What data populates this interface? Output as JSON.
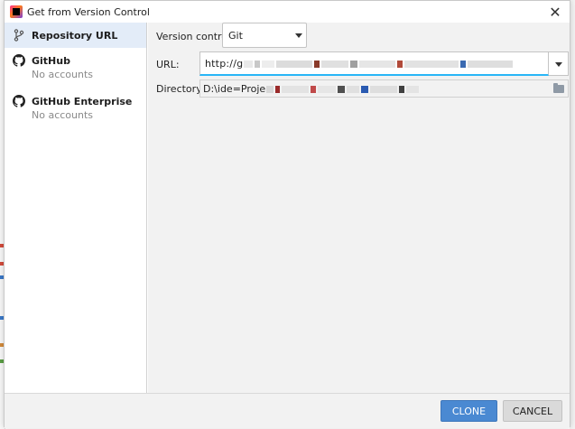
{
  "window": {
    "title": "Get from Version Control",
    "close_glyph": "✕"
  },
  "sidebar": {
    "items": [
      {
        "label": "Repository URL",
        "sublabel": "",
        "icon": "branch-icon",
        "selected": true
      },
      {
        "label": "GitHub",
        "sublabel": "No accounts",
        "icon": "github-icon",
        "selected": false
      },
      {
        "label": "GitHub Enterprise",
        "sublabel": "No accounts",
        "icon": "github-icon",
        "selected": false
      }
    ]
  },
  "form": {
    "vc_label": "Version control:",
    "vc_value": "Git",
    "url_label": "URL:",
    "url_value": "http://g",
    "dir_label": "Directory:",
    "dir_value": "D:\\ide=Proje"
  },
  "buttons": {
    "clone": "CLONE",
    "cancel": "CANCEL"
  },
  "colors": {
    "accent": "#4a89d2",
    "focus": "#29b6f6",
    "selected_row": "#e3ecf8"
  }
}
